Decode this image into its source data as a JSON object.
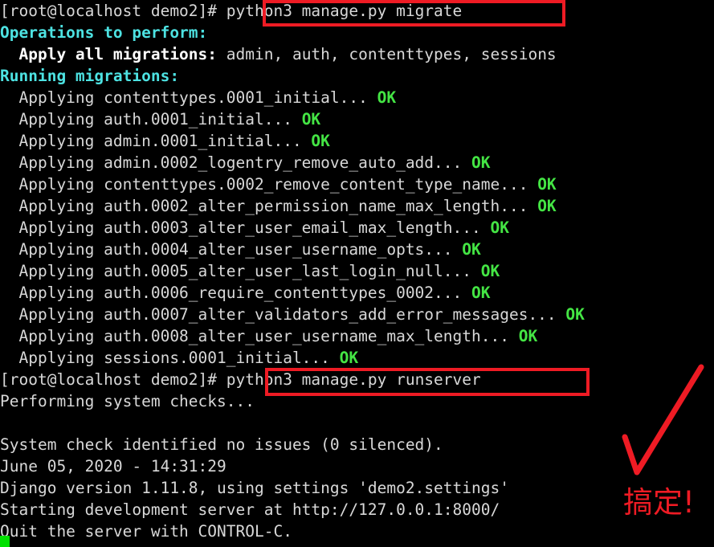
{
  "terminal": {
    "background_color": "#000000",
    "foreground_color": "#d8d8d8",
    "cyan_color": "#4de2e2",
    "green_color": "#44e544",
    "annotation_color": "#ee1b24",
    "cursor_color": "#00e000",
    "prompt": "[root@localhost demo2]#",
    "lines": [
      {
        "id": "line-prompt-migrate",
        "segments": [
          {
            "text": "[root@localhost demo2]# ",
            "style": "c-white"
          },
          {
            "text": "python3 manage.py migrate",
            "style": "c-white"
          }
        ]
      },
      {
        "id": "line-operations",
        "segments": [
          {
            "text": "Operations to perform:",
            "style": "c-cyan"
          }
        ]
      },
      {
        "id": "line-apply-all",
        "segments": [
          {
            "text": "  Apply all migrations:",
            "style": "c-bwhite"
          },
          {
            "text": " admin, auth, contenttypes, sessions",
            "style": "c-white"
          }
        ]
      },
      {
        "id": "line-running",
        "segments": [
          {
            "text": "Running migrations:",
            "style": "c-cyan"
          }
        ]
      },
      {
        "id": "line-mig-1",
        "segments": [
          {
            "text": "  Applying contenttypes.0001_initial...",
            "style": "c-white"
          },
          {
            "text": " OK",
            "style": "c-green"
          }
        ]
      },
      {
        "id": "line-mig-2",
        "segments": [
          {
            "text": "  Applying auth.0001_initial...",
            "style": "c-white"
          },
          {
            "text": " OK",
            "style": "c-green"
          }
        ]
      },
      {
        "id": "line-mig-3",
        "segments": [
          {
            "text": "  Applying admin.0001_initial...",
            "style": "c-white"
          },
          {
            "text": " OK",
            "style": "c-green"
          }
        ]
      },
      {
        "id": "line-mig-4",
        "segments": [
          {
            "text": "  Applying admin.0002_logentry_remove_auto_add...",
            "style": "c-white"
          },
          {
            "text": " OK",
            "style": "c-green"
          }
        ]
      },
      {
        "id": "line-mig-5",
        "segments": [
          {
            "text": "  Applying contenttypes.0002_remove_content_type_name...",
            "style": "c-white"
          },
          {
            "text": " OK",
            "style": "c-green"
          }
        ]
      },
      {
        "id": "line-mig-6",
        "segments": [
          {
            "text": "  Applying auth.0002_alter_permission_name_max_length...",
            "style": "c-white"
          },
          {
            "text": " OK",
            "style": "c-green"
          }
        ]
      },
      {
        "id": "line-mig-7",
        "segments": [
          {
            "text": "  Applying auth.0003_alter_user_email_max_length...",
            "style": "c-white"
          },
          {
            "text": " OK",
            "style": "c-green"
          }
        ]
      },
      {
        "id": "line-mig-8",
        "segments": [
          {
            "text": "  Applying auth.0004_alter_user_username_opts...",
            "style": "c-white"
          },
          {
            "text": " OK",
            "style": "c-green"
          }
        ]
      },
      {
        "id": "line-mig-9",
        "segments": [
          {
            "text": "  Applying auth.0005_alter_user_last_login_null...",
            "style": "c-white"
          },
          {
            "text": " OK",
            "style": "c-green"
          }
        ]
      },
      {
        "id": "line-mig-10",
        "segments": [
          {
            "text": "  Applying auth.0006_require_contenttypes_0002...",
            "style": "c-white"
          },
          {
            "text": " OK",
            "style": "c-green"
          }
        ]
      },
      {
        "id": "line-mig-11",
        "segments": [
          {
            "text": "  Applying auth.0007_alter_validators_add_error_messages...",
            "style": "c-white"
          },
          {
            "text": " OK",
            "style": "c-green"
          }
        ]
      },
      {
        "id": "line-mig-12",
        "segments": [
          {
            "text": "  Applying auth.0008_alter_user_username_max_length...",
            "style": "c-white"
          },
          {
            "text": " OK",
            "style": "c-green"
          }
        ]
      },
      {
        "id": "line-mig-13",
        "segments": [
          {
            "text": "  Applying sessions.0001_initial...",
            "style": "c-white"
          },
          {
            "text": " OK",
            "style": "c-green"
          }
        ]
      },
      {
        "id": "line-prompt-runserver",
        "segments": [
          {
            "text": "[root@localhost demo2]# ",
            "style": "c-white"
          },
          {
            "text": "python3 manage.py runserver",
            "style": "c-white"
          }
        ]
      },
      {
        "id": "line-performing",
        "segments": [
          {
            "text": "Performing system checks...",
            "style": "c-white"
          }
        ]
      },
      {
        "id": "line-blank-1",
        "segments": [
          {
            "text": "",
            "style": "c-white"
          }
        ]
      },
      {
        "id": "line-syscheck",
        "segments": [
          {
            "text": "System check identified no issues (0 silenced).",
            "style": "c-white"
          }
        ]
      },
      {
        "id": "line-date",
        "segments": [
          {
            "text": "June 05, 2020 - 14:31:29",
            "style": "c-white"
          }
        ]
      },
      {
        "id": "line-version",
        "segments": [
          {
            "text": "Django version 1.11.8, using settings 'demo2.settings'",
            "style": "c-white"
          }
        ]
      },
      {
        "id": "line-starting",
        "segments": [
          {
            "text": "Starting development server at http://127.0.0.1:8000/",
            "style": "c-white"
          }
        ]
      },
      {
        "id": "line-quit",
        "segments": [
          {
            "text": "Quit the server with CONTROL-C.",
            "style": "c-white"
          }
        ]
      }
    ]
  },
  "annotations": {
    "box_migrate_label": "python3 manage.py migrate",
    "box_runserver_label": "python3 manage.py runserver",
    "checkmark_label": "check-mark",
    "note_text": "搞定!"
  }
}
